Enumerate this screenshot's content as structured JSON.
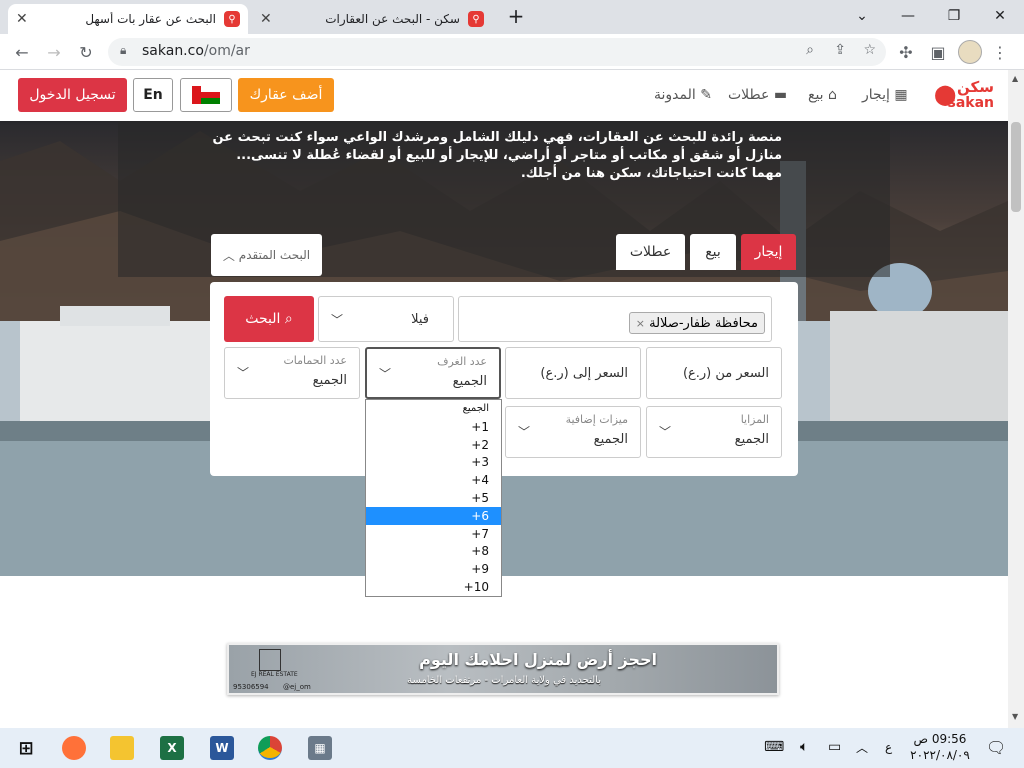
{
  "browser": {
    "tabs": [
      {
        "title": "البحث عن عقار بات أسهل",
        "active": true
      },
      {
        "title": "سكن - البحث عن العقارات",
        "active": false
      }
    ],
    "new_tab": "+",
    "url_host": "sakan.co",
    "url_path": "/om/ar"
  },
  "header": {
    "logo_ar": "سكن",
    "logo_en": "sakan",
    "nav": {
      "rent": "إيجار",
      "sale": "بيع",
      "holidays": "عطلات",
      "blog": "المدونة"
    },
    "add_property": "أضف عقارك",
    "lang": "En",
    "login": "تسجيل الدخول",
    "colors": {
      "red": "#dc3545",
      "orange": "#f7941d"
    }
  },
  "hero": {
    "description": "منصة رائدة للبحث عن العقارات، فهي دليلك الشامل ومرشدك الواعي سواء كنت تبحث عن منازل أو شقق أو مكاتب أو متاجر أو أراضي، للإيجار أو للبيع أو لقضاء عُطلة لا تنسى... مهما كانت احتياجاتك، سكن هنا من أجلك.",
    "tabs": [
      "إيجار",
      "بيع",
      "عطلات"
    ],
    "advanced_search": "البحث المتقدم"
  },
  "search": {
    "location_tag": "محافظة ظفار-صلالة",
    "type": "فيلا",
    "search_button": "البحث",
    "price_from": "السعر من (ر.ع)",
    "price_to": "السعر إلى (ر.ع)",
    "rooms_label": "عدد الغرف",
    "rooms_value": "الجميع",
    "baths_label": "عدد الحمامات",
    "baths_value": "الجميع",
    "features_label": "المزايا",
    "features_value": "الجميع",
    "extras_label": "ميزات إضافية",
    "extras_value": "الجميع"
  },
  "rooms_dropdown": {
    "options": [
      "الجميع",
      "1+",
      "2+",
      "3+",
      "4+",
      "5+",
      "6+",
      "7+",
      "8+",
      "9+",
      "10+"
    ],
    "highlighted": "6+"
  },
  "banner": {
    "headline": "احجز أرض لمنزل احلامك اليوم",
    "subline": "بالتحديد في ولاية العامرات - مرتفعات الخامسة",
    "brand": "EJ REAL ESTATE",
    "phone": "95306594",
    "handle": "@ej_om"
  },
  "taskbar": {
    "time": "09:56 ص",
    "date": "٢٠٢٢/٠٨/٠٩",
    "lang_indicator": "ع"
  }
}
